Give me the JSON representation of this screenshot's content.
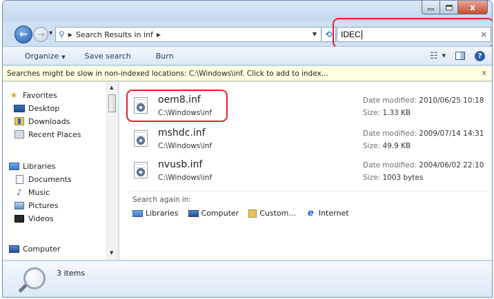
{
  "window": {
    "caption_close": "x"
  },
  "address_bar": {
    "location": "Search Results in inf",
    "refresh_glyph": "⟲"
  },
  "search": {
    "value": "IDEC",
    "clear_glyph": "×"
  },
  "toolbar": {
    "organize": "Organize",
    "save_search": "Save search",
    "burn": "Burn"
  },
  "infobar": {
    "message": "Searches might be slow in non-indexed locations: C:\\Windows\\inf. Click to add to index...",
    "close_glyph": "x"
  },
  "navigation": {
    "favorites": "Favorites",
    "desktop": "Desktop",
    "downloads": "Downloads",
    "recent_places": "Recent Places",
    "libraries": "Libraries",
    "documents": "Documents",
    "music": "Music",
    "pictures": "Pictures",
    "videos": "Videos",
    "computer": "Computer"
  },
  "results": [
    {
      "name": "oem8.inf",
      "path": "C:\\Windows\\inf",
      "date_label": "Date modified:",
      "date": "2010/06/25 10:18",
      "size_label": "Size:",
      "size": "1.33 KB"
    },
    {
      "name": "mshdc.inf",
      "path": "C:\\Windows\\inf",
      "date_label": "Date modified:",
      "date": "2009/07/14 14:31",
      "size_label": "Size:",
      "size": "49.9 KB"
    },
    {
      "name": "nvusb.inf",
      "path": "C:\\Windows\\inf",
      "date_label": "Date modified:",
      "date": "2004/06/02 22:10",
      "size_label": "Size:",
      "size": "1003 bytes"
    }
  ],
  "search_again": {
    "label": "Search again in:",
    "libraries": "Libraries",
    "computer": "Computer",
    "custom": "Custom...",
    "internet": "Internet"
  },
  "details": {
    "item_count": "3 items"
  },
  "colors": {
    "highlight": "#e0212a",
    "infobar_bg": "#ffffe1",
    "window_frame": "#cfe0f3"
  }
}
